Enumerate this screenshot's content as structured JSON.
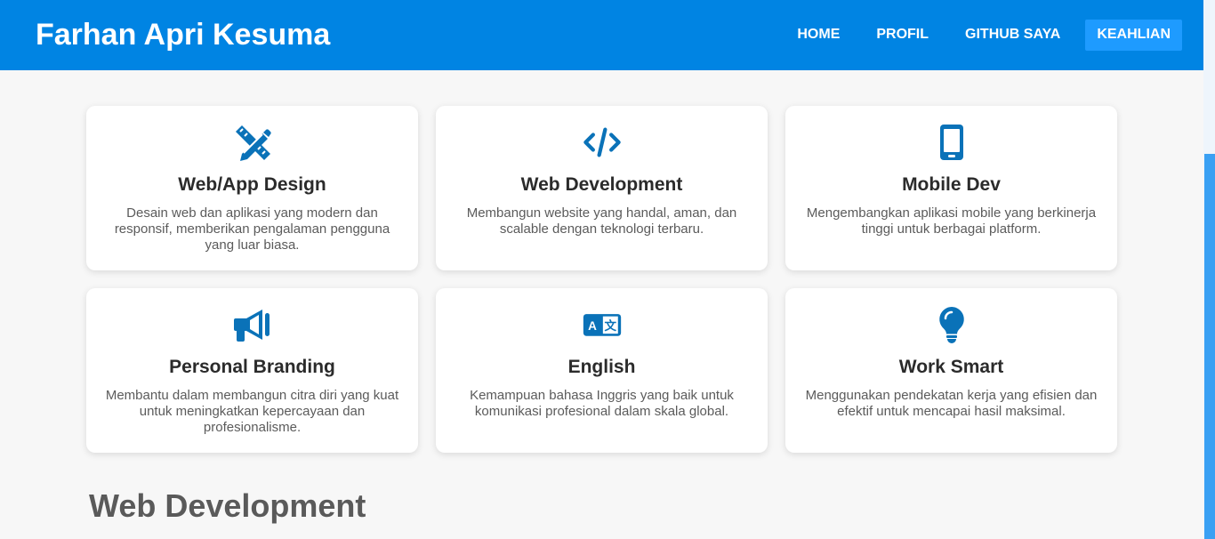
{
  "header": {
    "brand": "Farhan Apri Kesuma",
    "nav": [
      {
        "label": "HOME",
        "active": false
      },
      {
        "label": "PROFIL",
        "active": false
      },
      {
        "label": "GITHUB SAYA",
        "active": false
      },
      {
        "label": "KEAHLIAN",
        "active": true
      }
    ],
    "bg_color": "#0084e3",
    "active_color": "#1e9bff"
  },
  "cards": [
    {
      "icon": "pencil-ruler-icon",
      "title": "Web/App Design",
      "description": "Desain web dan aplikasi yang modern dan responsif, memberikan pengalaman pengguna yang luar biasa."
    },
    {
      "icon": "code-icon",
      "title": "Web Development",
      "description": "Membangun website yang handal, aman, dan scalable dengan teknologi terbaru."
    },
    {
      "icon": "mobile-icon",
      "title": "Mobile Dev",
      "description": "Mengembangkan aplikasi mobile yang berkinerja tinggi untuk berbagai platform."
    },
    {
      "icon": "megaphone-icon",
      "title": "Personal Branding",
      "description": "Membantu dalam membangun citra diri yang kuat untuk meningkatkan kepercayaan dan profesionalisme."
    },
    {
      "icon": "language-icon",
      "title": "English",
      "description": "Kemampuan bahasa Inggris yang baik untuk komunikasi profesional dalam skala global."
    },
    {
      "icon": "lightbulb-icon",
      "title": "Work Smart",
      "description": "Menggunakan pendekatan kerja yang efisien dan efektif untuk mencapai hasil maksimal."
    }
  ],
  "icon_color": "#0a72b8",
  "section": {
    "heading": "Web Development"
  }
}
